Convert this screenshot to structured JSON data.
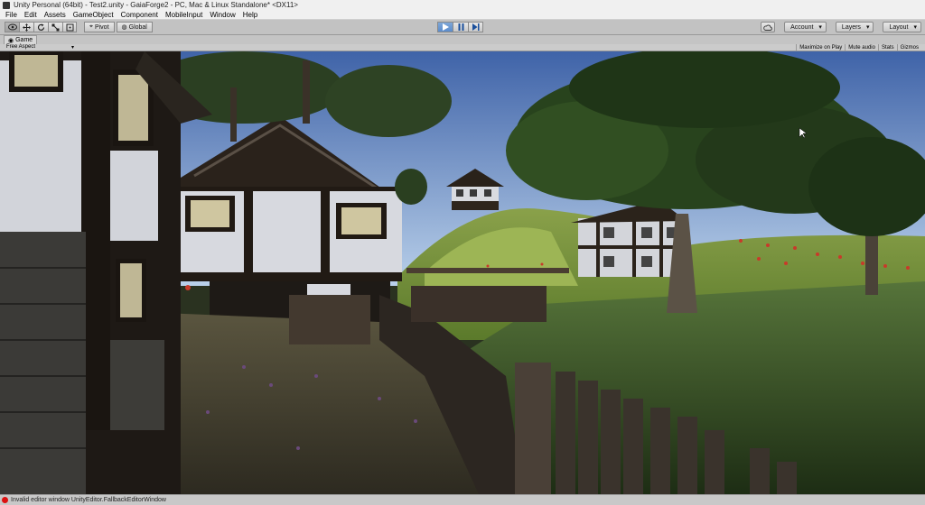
{
  "window": {
    "title": "Unity Personal (64bit) - Test2.unity - GaiaForge2 - PC, Mac & Linux Standalone* <DX11>"
  },
  "menu": [
    "File",
    "Edit",
    "Assets",
    "GameObject",
    "Component",
    "MobileInput",
    "Window",
    "Help"
  ],
  "toolbar": {
    "transform_tools": [
      "hand-tool-icon",
      "move-tool-icon",
      "rotate-tool-icon",
      "scale-tool-icon",
      "rect-tool-icon"
    ],
    "pivot_label": "Pivot",
    "global_label": "Global",
    "account_label": "Account",
    "layers_label": "Layers",
    "layout_label": "Layout",
    "play_state": {
      "playing": true,
      "paused": false
    }
  },
  "game_tab": {
    "label": "Game"
  },
  "game_bar": {
    "aspect_label": "Free Aspect",
    "maximize_label": "Maximize on Play",
    "mute_label": "Mute audio",
    "stats_label": "Stats",
    "gizmos_label": "Gizmos"
  },
  "status": {
    "message": "Invalid editor window UnityEditor.FallbackEditorWindow"
  },
  "colors": {
    "sky": "#5f87c8",
    "grass": "#4d6a2a",
    "wall": "#d7d9df",
    "timber": "#211a14"
  }
}
